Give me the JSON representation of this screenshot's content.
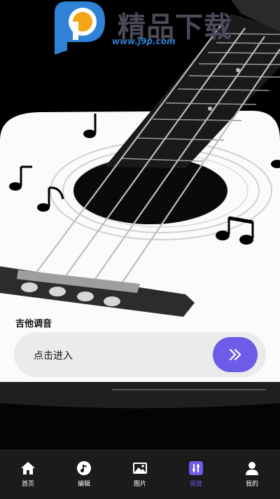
{
  "watermark": {
    "brand_cn": "精品下载",
    "url": "www.j9p.com"
  },
  "section": {
    "title": "吉他调音"
  },
  "enter": {
    "label": "点击进入",
    "button_icon": "double-chevron-right-icon"
  },
  "tabbar": {
    "items": [
      {
        "label": "首页",
        "icon": "home-icon",
        "active": false
      },
      {
        "label": "编辑",
        "icon": "music-note-icon",
        "active": false
      },
      {
        "label": "图片",
        "icon": "image-icon",
        "active": false
      },
      {
        "label": "调音",
        "icon": "tuner-sliders-icon",
        "active": true
      },
      {
        "label": "我的",
        "icon": "user-icon",
        "active": false
      }
    ]
  },
  "colors": {
    "accent": "#6d5ce8",
    "background": "#000000",
    "tabbar": "#1b1b1b",
    "bar": "#ebebeb"
  }
}
